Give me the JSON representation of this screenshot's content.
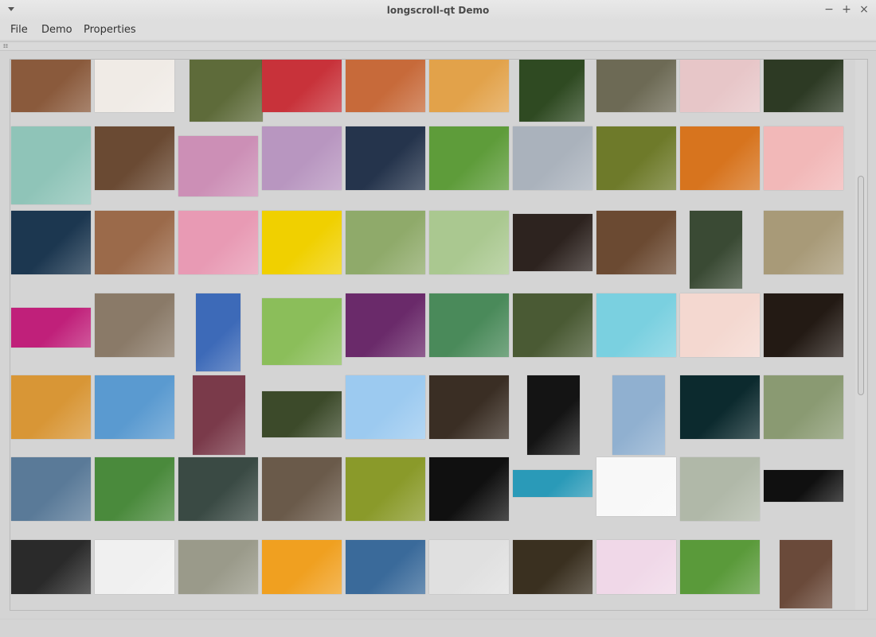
{
  "window": {
    "title": "longscroll-qt Demo"
  },
  "window_controls": {
    "minimize": "−",
    "maximize": "+",
    "close": "×"
  },
  "menu": {
    "file": "File",
    "demo": "Demo",
    "properties": "Properties"
  },
  "gallery": {
    "description": "Thumbnail grid, scrolled partway",
    "scroll_position": 0.21,
    "rows": [
      [
        "#8a5a3c",
        "#f0ebe6",
        "#5e6b3a",
        "#c8323a",
        "#c76a3a",
        "#e2a24a",
        "#2f4a22",
        "#6d6a55",
        "#e7c6c8",
        "#2d3a24"
      ],
      [
        "#8fc4b8",
        "#6a4a33",
        "#cc8fb6",
        "#b896c0",
        "#25344c",
        "#5e9c3a",
        "#aab2bc",
        "#6e7a2a",
        "#d7741e",
        "#f2b8b8"
      ],
      [
        "#1c3750",
        "#9b6a4a",
        "#e89ab4",
        "#f0d000",
        "#8faa6a",
        "#aac890",
        "#2d231f",
        "#6b4a32",
        "#3a4a34",
        "#a89a78"
      ],
      [
        "#c0207a",
        "#8a7a68",
        "#3d6ab8",
        "#8bbe5a",
        "#6a2a6a",
        "#4a8a5a",
        "#4a5a34",
        "#7ad0e0",
        "#f4d8d0",
        "#231a14"
      ],
      [
        "#d89636",
        "#5a9ad0",
        "#7a3a4a",
        "#3c4a2a",
        "#9ccaf0",
        "#3a2e24",
        "#141414",
        "#90b0d0",
        "#0c2a2e",
        "#8a9a72"
      ],
      [
        "#5a7a98",
        "#4a8a3c",
        "#3a4a44",
        "#6a5a4a",
        "#8a9a2a",
        "#101010",
        "#2a9ab8",
        "#f8f8f8",
        "#b0b8a8",
        "#101010"
      ],
      [
        "#2a2a2a",
        "#f0f0f0",
        "#9a9a8a",
        "#f0a020",
        "#3a6a9a",
        "#e0e0e0",
        "#3a3020",
        "#f0d8e8",
        "#5a9a3a",
        "#6a4a3a"
      ]
    ]
  }
}
